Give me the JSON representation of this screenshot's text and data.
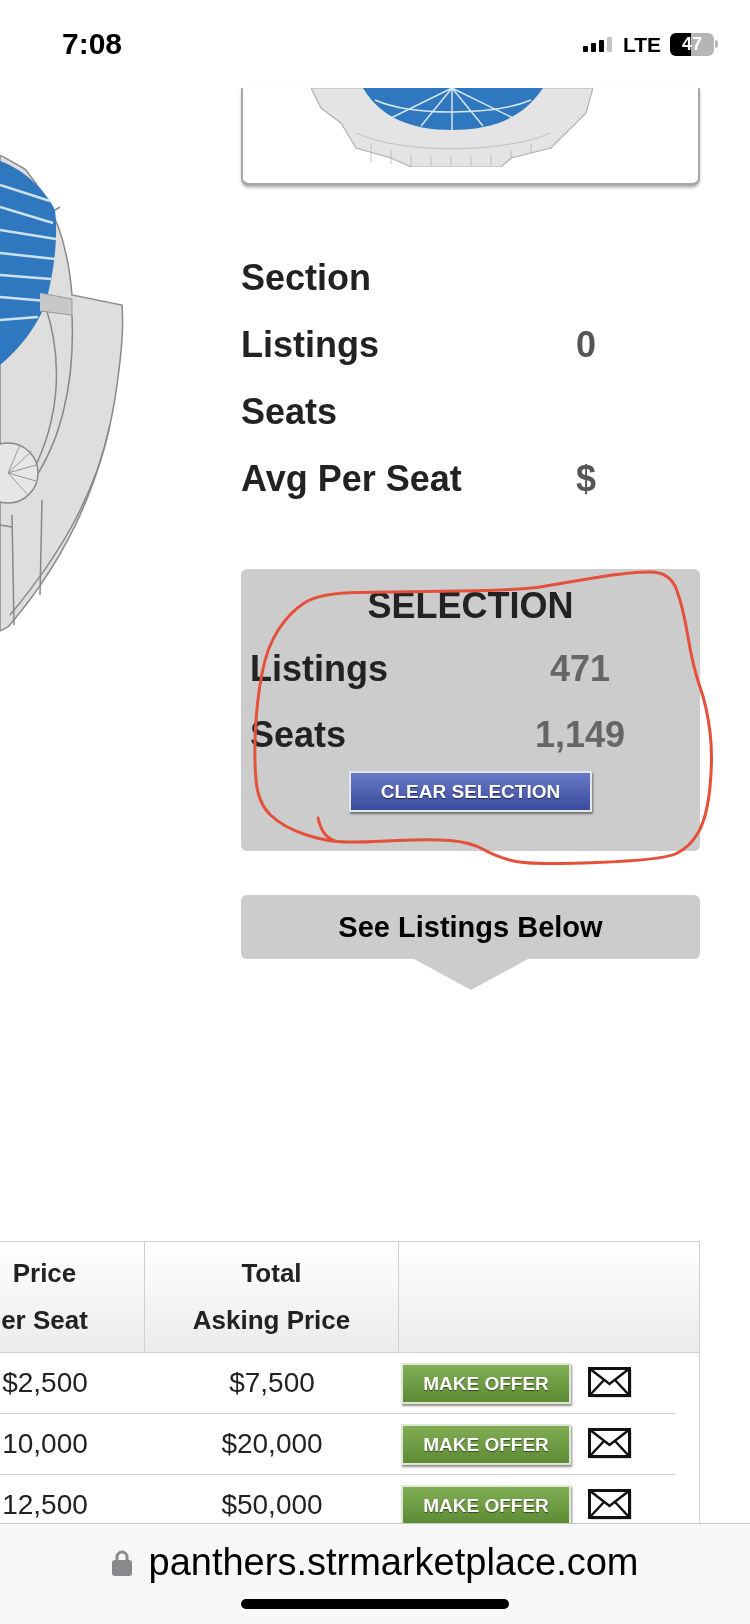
{
  "status_bar": {
    "time": "7:08",
    "network": "LTE",
    "battery": "47"
  },
  "section_summary": {
    "rows": [
      {
        "label": "Section"
      },
      {
        "label": "Listings",
        "value": "0"
      },
      {
        "label": "Seats"
      },
      {
        "label": "Avg Per Seat",
        "value": "$"
      }
    ]
  },
  "selection": {
    "title": "SELECTION",
    "rows": [
      {
        "label": "Listings",
        "value": "471"
      },
      {
        "label": "Seats",
        "value": "1,149"
      }
    ],
    "clear_button": "CLEAR SELECTION"
  },
  "see_listings_button": "See Listings Below",
  "listings_table": {
    "columns": [
      {
        "heading": [
          "Price",
          "er Seat"
        ]
      },
      {
        "heading": [
          "Total",
          "Asking Price"
        ]
      }
    ],
    "rows": [
      {
        "price_per_seat": "$2,500",
        "total_asking_price": "$7,500",
        "offer_button": "MAKE OFFER"
      },
      {
        "price_per_seat": "10,000",
        "total_asking_price": "$20,000",
        "offer_button": "MAKE OFFER"
      },
      {
        "price_per_seat": "12,500",
        "total_asking_price": "$50,000",
        "offer_button": "MAKE OFFER"
      }
    ]
  },
  "browser_bar": {
    "url": "panthers.strmarketplace.com"
  }
}
